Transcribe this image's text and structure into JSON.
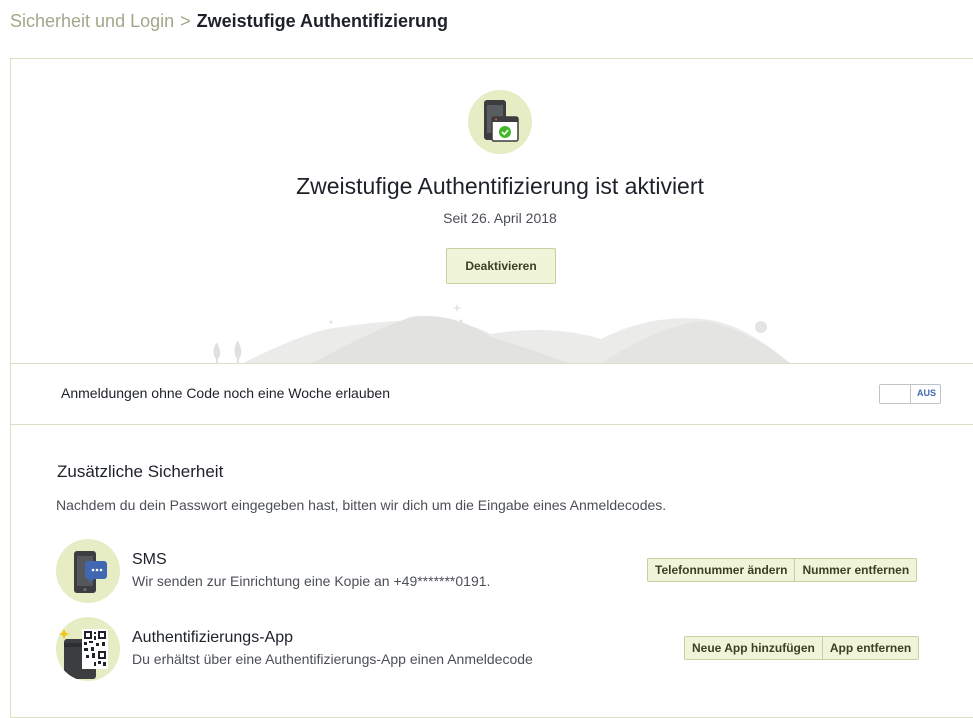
{
  "breadcrumb": {
    "parent": "Sicherheit und Login",
    "separator": ">",
    "current": "Zweistufige Authentifizierung"
  },
  "hero": {
    "icon": "phone-with-check-icon",
    "title": "Zweistufige Authentifizierung ist aktiviert",
    "since": "Seit 26. April 2018",
    "deactivate_label": "Deaktivieren"
  },
  "allow_logins": {
    "label": "Anmeldungen ohne Code noch eine Woche erlauben",
    "toggle_state": "AUS"
  },
  "extra_security": {
    "title": "Zusätzliche Sicherheit",
    "description": "Nachdem du dein Passwort eingegeben hast, bitten wir dich um die Eingabe eines Anmeldecodes.",
    "methods": [
      {
        "name": "SMS",
        "description": "Wir senden zur Einrichtung eine Kopie an +49*******0191.",
        "icon": "phone-chat-icon",
        "buttons": [
          "Telefonnummer ändern",
          "Nummer entfernen"
        ]
      },
      {
        "name": "Authentifizierungs-App",
        "description": "Du erhältst über eine Authentifizierungs-App einen Anmeldecode",
        "icon": "qr-code-phone-icon",
        "buttons": [
          "Neue App hinzufügen",
          "App entfernen"
        ]
      }
    ]
  },
  "colors": {
    "accent_bg": "#f0f4d9",
    "icon_circle": "#e6ecc3",
    "border": "#dcdfc4",
    "toggle_text": "#4267b2"
  }
}
